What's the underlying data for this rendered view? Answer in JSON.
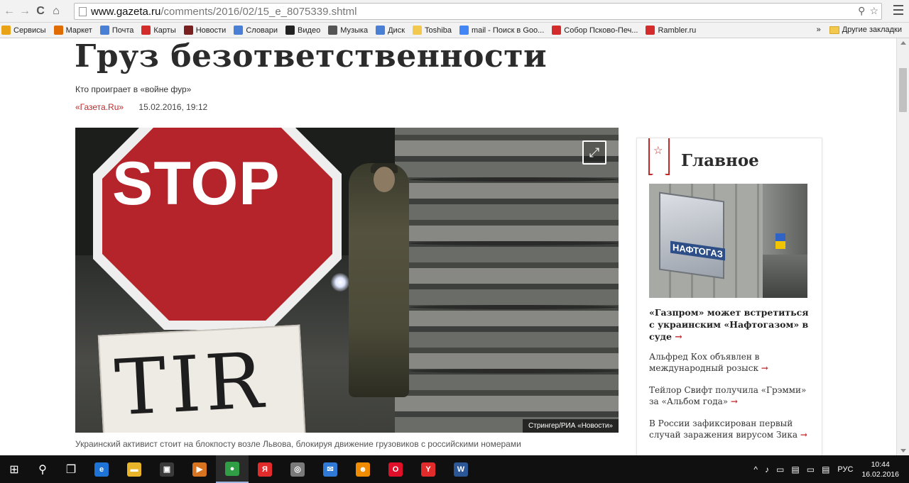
{
  "browser": {
    "url_host": "www.gazeta.ru",
    "url_path": "/comments/2016/02/15_e_8075339.shtml",
    "bookmarks": [
      {
        "label": "Сервисы",
        "icon": "apps-icon",
        "color": "#e8a317"
      },
      {
        "label": "Маркет",
        "icon": "market-icon",
        "color": "#e06b00"
      },
      {
        "label": "Почта",
        "icon": "mail-icon",
        "color": "#4a7fd6"
      },
      {
        "label": "Карты",
        "icon": "map-pin-icon",
        "color": "#d42b2b"
      },
      {
        "label": "Новости",
        "icon": "news-icon",
        "color": "#7a2020"
      },
      {
        "label": "Словари",
        "icon": "dictionary-icon",
        "color": "#4a7fd6"
      },
      {
        "label": "Видео",
        "icon": "video-icon",
        "color": "#222222"
      },
      {
        "label": "Музыка",
        "icon": "music-icon",
        "color": "#555555"
      },
      {
        "label": "Диск",
        "icon": "disk-icon",
        "color": "#4a7fd6"
      },
      {
        "label": "Toshiba",
        "icon": "folder-icon",
        "color": "#f2c94c"
      },
      {
        "label": "mail - Поиск в Goo...",
        "icon": "google-icon",
        "color": "#4285f4"
      },
      {
        "label": "Собор Псково-Печ...",
        "icon": "yandex-icon",
        "color": "#d42b2b"
      },
      {
        "label": "Rambler.ru",
        "icon": "yandex-icon",
        "color": "#d42b2b"
      }
    ],
    "more_label": "»",
    "other_bookmarks_label": "Другие закладки"
  },
  "article": {
    "title": "Груз безответственности",
    "subtitle": "Кто проиграет в «войне фур»",
    "source": "«Газета.Ru»",
    "date": "15.02.2016, 19:12",
    "photo_sign_top": "STOP",
    "photo_sign_bottom": "TIR",
    "photo_credit": "Стрингер/РИА «Новости»",
    "caption": "Украинский активист стоит на блокпосту возле Львова, блокируя движение грузовиков с российскими номерами"
  },
  "sidebar": {
    "title": "Главное",
    "plaque_text": "НАФТОГАЗ",
    "lead": "«Газпром» может встретиться с украинским «Нафтогазом» в суде",
    "items": [
      "Альфред Кох объявлен в международный розыск",
      "Тейлор Свифт получила «Грэмми» за «Альбом года»",
      "В России зафиксирован первый случай заражения вирусом Зика"
    ],
    "arrow": "→"
  },
  "taskbar": {
    "language": "РУС",
    "time": "10:44",
    "date": "16.02.2016",
    "apps": [
      {
        "icon": "edge-icon",
        "label": "e",
        "color": "#1e73d6"
      },
      {
        "icon": "explorer-icon",
        "label": "▬",
        "color": "#e8b52a"
      },
      {
        "icon": "store-icon",
        "label": "▣",
        "color": "#ffffff"
      },
      {
        "icon": "media-icon",
        "label": "▶",
        "color": "#d8731f"
      },
      {
        "icon": "chrome-icon",
        "label": "●",
        "color": "#2f9e44"
      },
      {
        "icon": "yandex-browser-icon",
        "label": "Я",
        "color": "#e22b2b"
      },
      {
        "icon": "circle-app-icon",
        "label": "◎",
        "color": "#7a7a7a"
      },
      {
        "icon": "mail-app-icon",
        "label": "✉",
        "color": "#2f7ad6"
      },
      {
        "icon": "odnoklassniki-icon",
        "label": "☻",
        "color": "#f08c00"
      },
      {
        "icon": "opera-icon",
        "label": "O",
        "color": "#e0102b"
      },
      {
        "icon": "yandex-icon",
        "label": "Y",
        "color": "#e22b2b"
      },
      {
        "icon": "word-icon",
        "label": "W",
        "color": "#2b5797"
      }
    ]
  },
  "colors": {
    "accent_red": "#c0282a",
    "title_text": "#2b2b2b"
  }
}
